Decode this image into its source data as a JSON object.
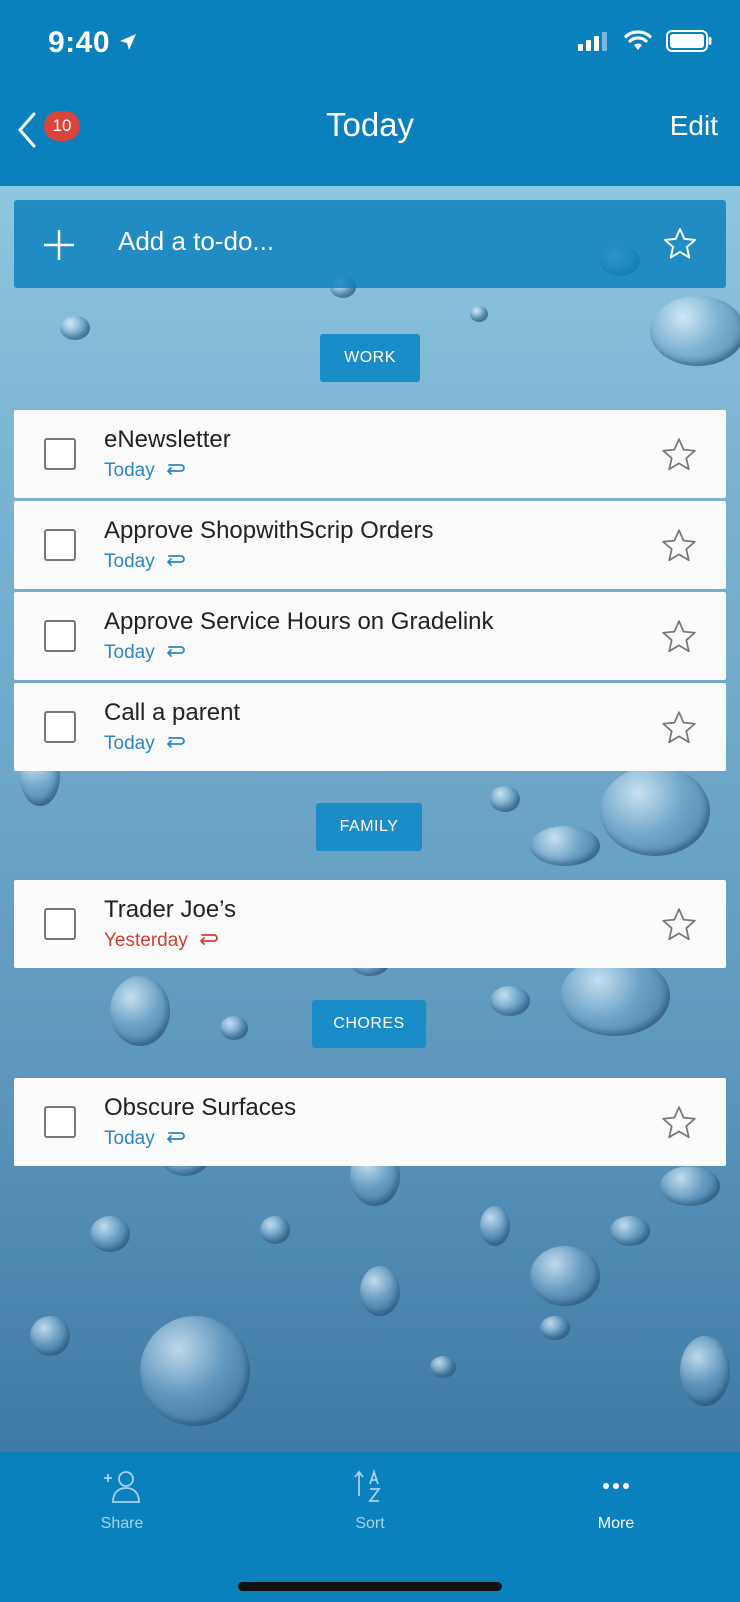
{
  "status_bar": {
    "time": "9:40"
  },
  "nav": {
    "back_badge": "10",
    "title": "Today",
    "edit_label": "Edit"
  },
  "add_bar": {
    "placeholder": "Add a to-do..."
  },
  "sections": [
    {
      "label": "WORK"
    },
    {
      "label": "FAMILY"
    },
    {
      "label": "CHORES"
    }
  ],
  "tasks": [
    {
      "title": "eNewsletter",
      "due": "Today",
      "overdue": false,
      "section": "WORK"
    },
    {
      "title": "Approve ShopwithScrip Orders",
      "due": "Today",
      "overdue": false,
      "section": "WORK"
    },
    {
      "title": "Approve Service Hours on Gradelink",
      "due": "Today",
      "overdue": false,
      "section": "WORK"
    },
    {
      "title": "Call a parent",
      "due": "Today",
      "overdue": false,
      "section": "WORK"
    },
    {
      "title": "Trader Joe’s",
      "due": "Yesterday",
      "overdue": true,
      "section": "FAMILY"
    },
    {
      "title": "Obscure Surfaces",
      "due": "Today",
      "overdue": false,
      "section": "CHORES"
    }
  ],
  "toolbar": {
    "share_label": "Share",
    "sort_label": "Sort",
    "more_label": "More"
  },
  "colors": {
    "accent": "#0a80bd",
    "due_today": "#2a87c6",
    "overdue": "#d33c30",
    "badge": "#d9453a"
  },
  "icons": [
    "back-chevron-icon",
    "plus-icon",
    "star-icon",
    "repeat-icon",
    "share-person-icon",
    "sort-az-icon",
    "more-dots-icon"
  ]
}
